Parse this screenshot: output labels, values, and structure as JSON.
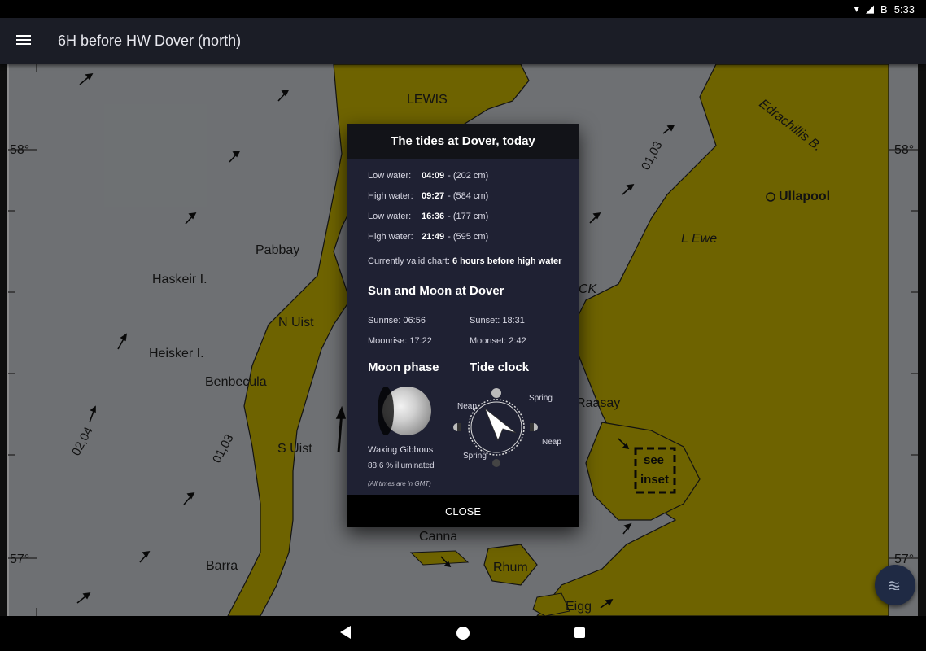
{
  "status_bar": {
    "time": "5:33",
    "battery": "B"
  },
  "app_bar": {
    "title": "6H before HW Dover (north)"
  },
  "map": {
    "lat_labels": [
      "58°",
      "58°",
      "57°",
      "57°"
    ],
    "place_labels": {
      "lewis": "LEWIS",
      "pabbay": "Pabbay",
      "haskeir": "Haskeir I.",
      "n_uist": "N Uist",
      "heisker": "Heisker I.",
      "benbecula": "Benbecula",
      "s_uist": "S Uist",
      "barra": "Barra",
      "canna": "Canna",
      "rhum": "Rhum",
      "eigg": "Eigg",
      "raasay": "Raasay",
      "ullapool": "Ullapool",
      "l_ewe": "L Ewe",
      "edrachillis": "Edrachillis B.",
      "minch_fragment": "CK",
      "see_inset": "see",
      "see_inset2": "inset"
    },
    "rate_labels": [
      "01,03",
      "02,04",
      "01,03"
    ]
  },
  "dialog": {
    "title": "The tides at Dover, today",
    "tides": [
      {
        "label": "Low water:",
        "time": "04:09",
        "height": "- (202 cm)"
      },
      {
        "label": "High water:",
        "time": "09:27",
        "height": "- (584 cm)"
      },
      {
        "label": "Low water:",
        "time": "16:36",
        "height": "- (177 cm)"
      },
      {
        "label": "High water:",
        "time": "21:49",
        "height": "- (595 cm)"
      }
    ],
    "chart_label": "Currently valid chart:",
    "chart_value": "6 hours before high water",
    "sun_moon_heading": "Sun and Moon at Dover",
    "sunrise": "Sunrise: 06:56",
    "sunset": "Sunset: 18:31",
    "moonrise": "Moonrise: 17:22",
    "moonset": "Moonset: 2:42",
    "moon_phase_heading": "Moon phase",
    "tide_clock_heading": "Tide clock",
    "moon_phase_name": "Waxing Gibbous",
    "illumination": "88.6 % illuminated",
    "gmt_note": "(All times are in GMT)",
    "clock_labels": {
      "spring_top": "Spring",
      "neap_left": "Neap",
      "neap_right": "Neap",
      "spring_bottom": "Spring"
    },
    "close_label": "CLOSE"
  },
  "colors": {
    "land": "#c8b400",
    "sea": "#c9cdd2",
    "dialog_bg": "#1f2133",
    "app_bar": "#1b1d26"
  }
}
